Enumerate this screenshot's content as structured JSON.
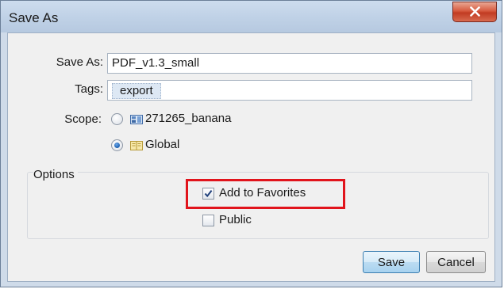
{
  "window": {
    "title": "Save As"
  },
  "form": {
    "save_as_label": "Save As:",
    "save_as_value": "PDF_v1.3_small",
    "tags_label": "Tags:",
    "tags": [
      "export"
    ],
    "scope_label": "Scope:",
    "scope_options": [
      {
        "label": "271265_banana",
        "selected": false,
        "icon": "dashboard-icon"
      },
      {
        "label": "Global",
        "selected": true,
        "icon": "book-icon"
      }
    ]
  },
  "options": {
    "title": "Options",
    "add_to_favorites_label": "Add to Favorites",
    "add_to_favorites_checked": true,
    "public_label": "Public",
    "public_checked": false
  },
  "buttons": {
    "save_label": "Save",
    "cancel_label": "Cancel"
  },
  "colors": {
    "highlight": "#e1141c",
    "default_button_border": "#3c7fb1"
  }
}
